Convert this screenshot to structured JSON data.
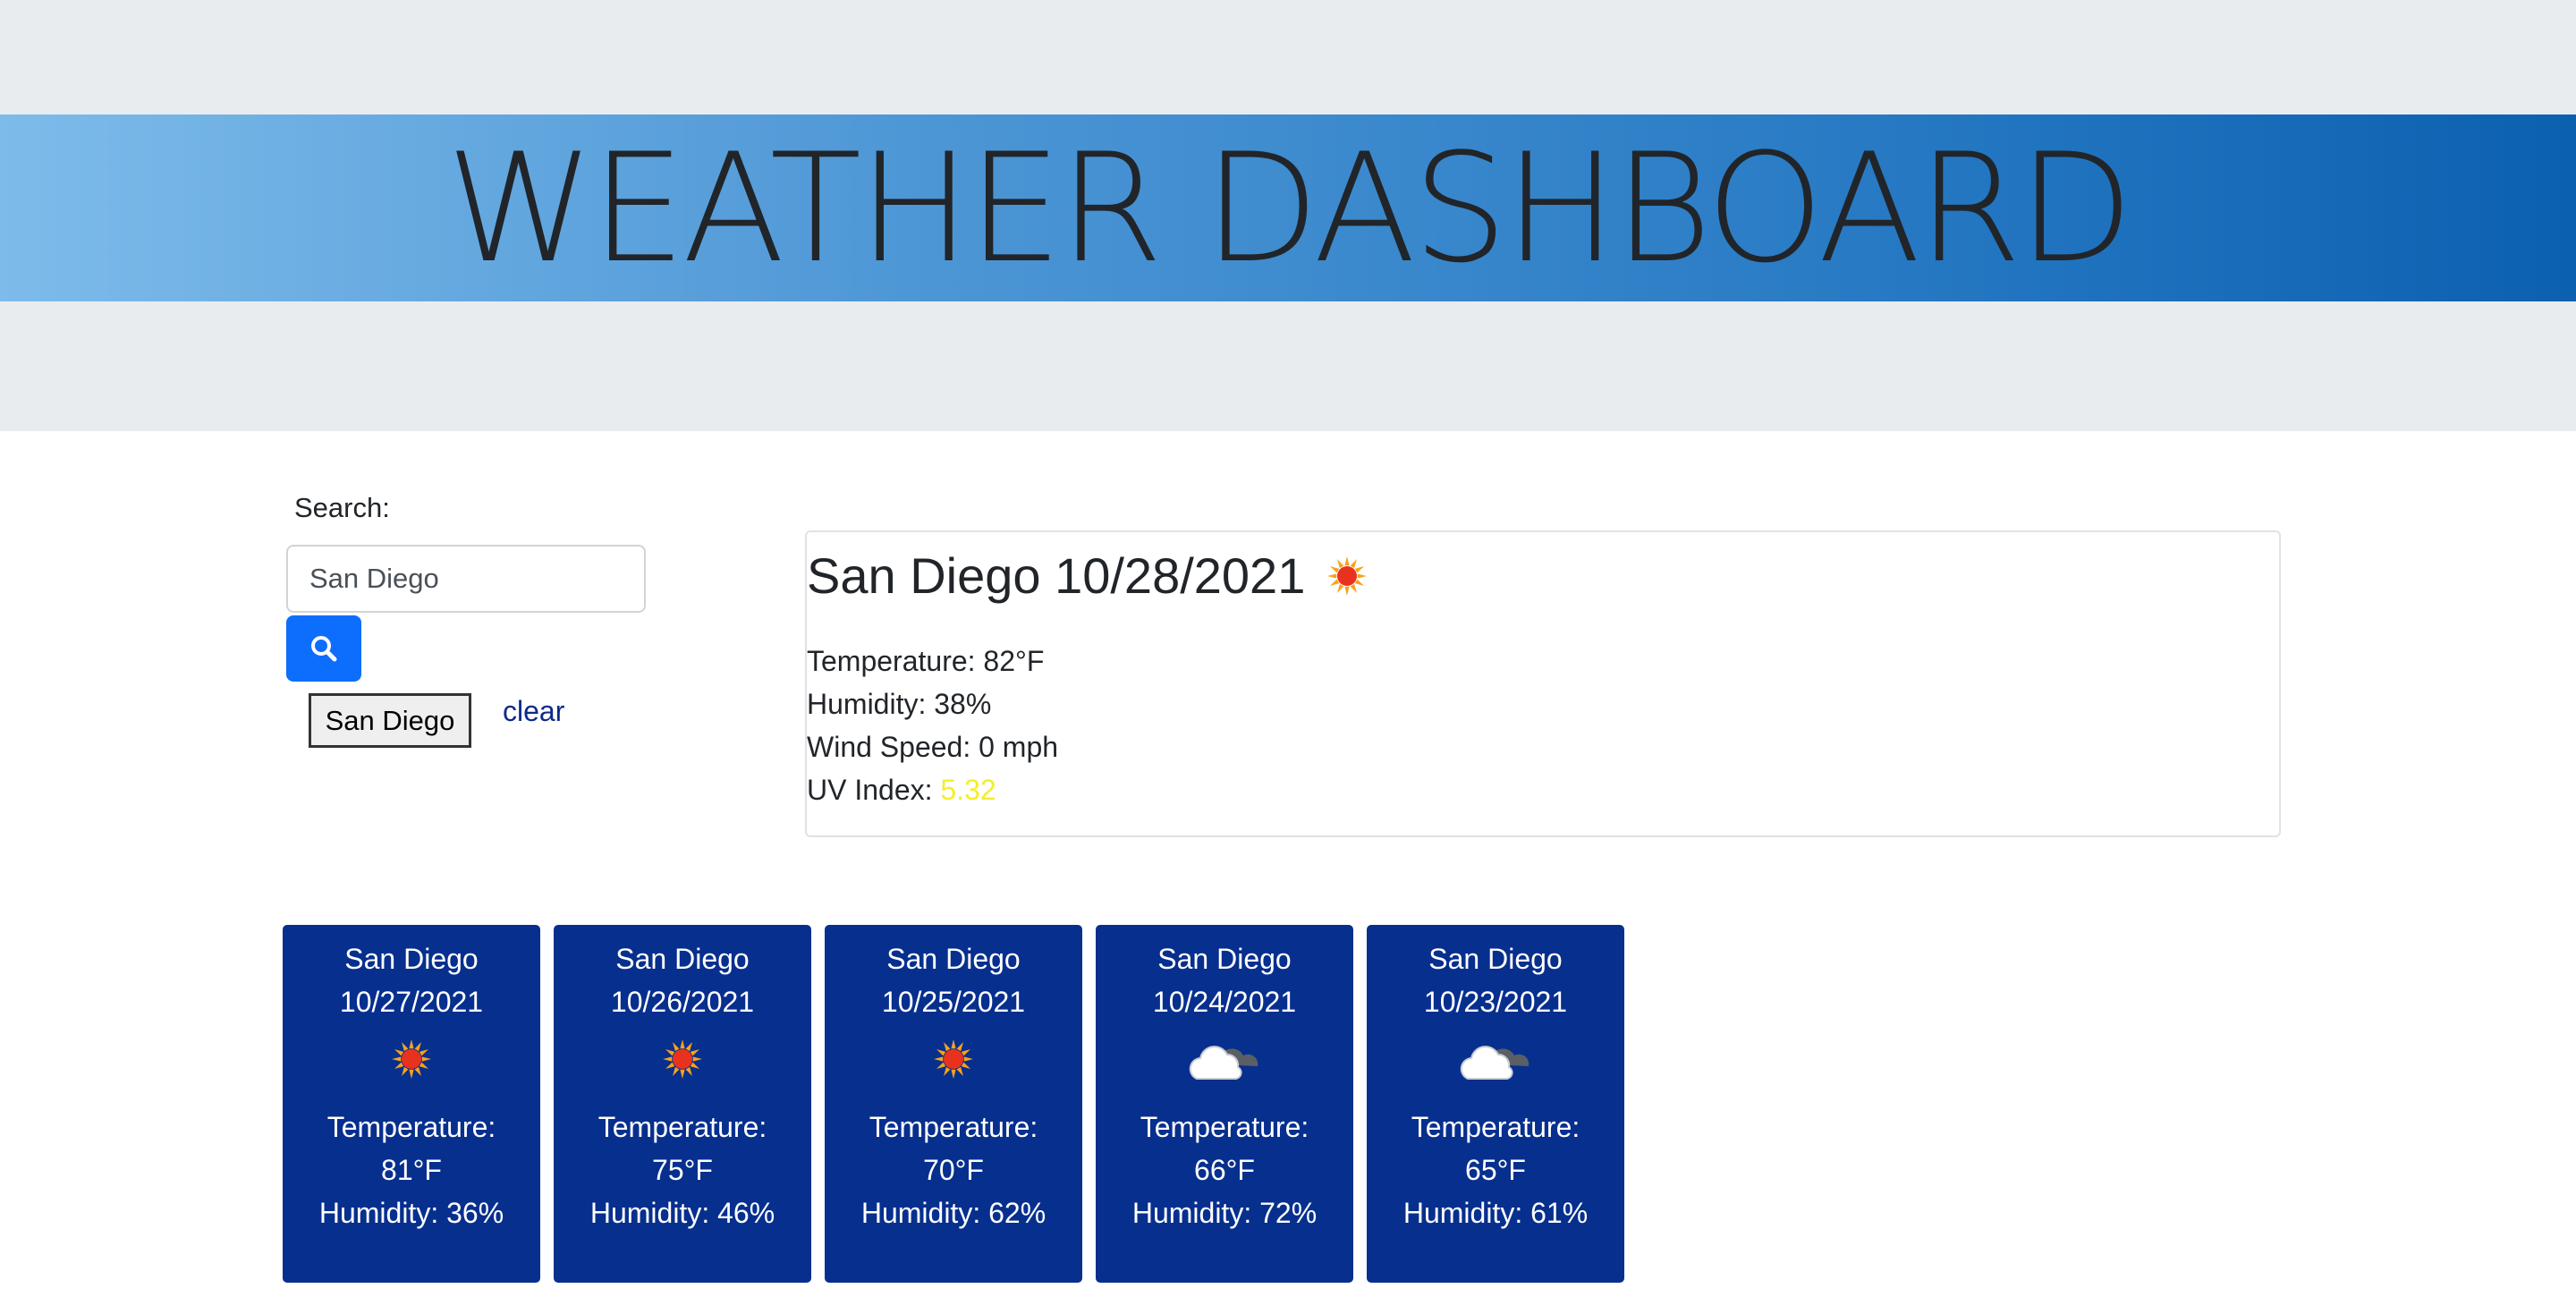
{
  "header": {
    "title": "WEATHER DASHBOARD"
  },
  "search": {
    "label": "Search:",
    "value": "San Diego",
    "button_icon": "search-icon",
    "history": [
      "San Diego"
    ],
    "clear_label": "clear"
  },
  "current": {
    "title": "San Diego 10/28/2021",
    "icon": "sun-icon",
    "temperature_label": "Temperature: 82°F",
    "humidity_label": "Humidity: 38%",
    "wind_label": "Wind Speed: 0 mph",
    "uv_prefix": "UV Index: ",
    "uv_value": "5.32",
    "uv_color": "#f2ef2a"
  },
  "forecast": [
    {
      "city": "San Diego",
      "date": "10/27/2021",
      "icon": "sun-icon",
      "temp_label": "Temperature:",
      "temp": "81°F",
      "humidity": "Humidity: 36%"
    },
    {
      "city": "San Diego",
      "date": "10/26/2021",
      "icon": "sun-icon",
      "temp_label": "Temperature:",
      "temp": "75°F",
      "humidity": "Humidity: 46%"
    },
    {
      "city": "San Diego",
      "date": "10/25/2021",
      "icon": "sun-icon",
      "temp_label": "Temperature:",
      "temp": "70°F",
      "humidity": "Humidity: 62%"
    },
    {
      "city": "San Diego",
      "date": "10/24/2021",
      "icon": "cloud-icon",
      "temp_label": "Temperature:",
      "temp": "66°F",
      "humidity": "Humidity: 72%"
    },
    {
      "city": "San Diego",
      "date": "10/23/2021",
      "icon": "cloud-icon",
      "temp_label": "Temperature:",
      "temp": "65°F",
      "humidity": "Humidity: 61%"
    }
  ],
  "colors": {
    "banner_start": "#7dbbea",
    "banner_end": "#0b60b0",
    "forecast_card": "#072f8e",
    "search_button": "#0d6efd"
  }
}
